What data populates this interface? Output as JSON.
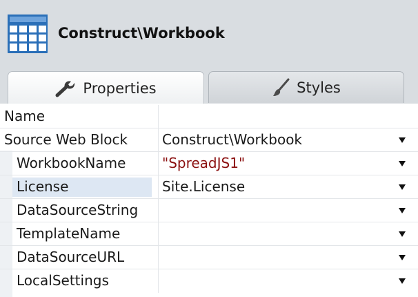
{
  "header": {
    "title": "Construct\\Workbook",
    "icon": "spreadsheet-grid-icon"
  },
  "tabs": [
    {
      "label": "Properties",
      "icon": "wrench-icon",
      "active": true
    },
    {
      "label": "Styles",
      "icon": "paintbrush-icon",
      "active": false
    }
  ],
  "properties": [
    {
      "name": "Name",
      "value": "",
      "dropdown": false
    },
    {
      "name": "Source Web Block",
      "value": "Construct\\Workbook",
      "dropdown": true
    },
    {
      "name": "WorkbookName",
      "value": "\"SpreadJS1\"",
      "dropdown": true,
      "string": true
    },
    {
      "name": "License",
      "value": "Site.License",
      "dropdown": true,
      "selected": true
    },
    {
      "name": "DataSourceString",
      "value": "",
      "dropdown": true
    },
    {
      "name": "TemplateName",
      "value": "",
      "dropdown": true
    },
    {
      "name": "DataSourceURL",
      "value": "",
      "dropdown": true
    },
    {
      "name": "LocalSettings",
      "value": "",
      "dropdown": true
    }
  ],
  "colors": {
    "accent": "#2a6fb8",
    "string_value": "#8b1010",
    "panel": "#ffffff",
    "background": "#d9dde1"
  }
}
